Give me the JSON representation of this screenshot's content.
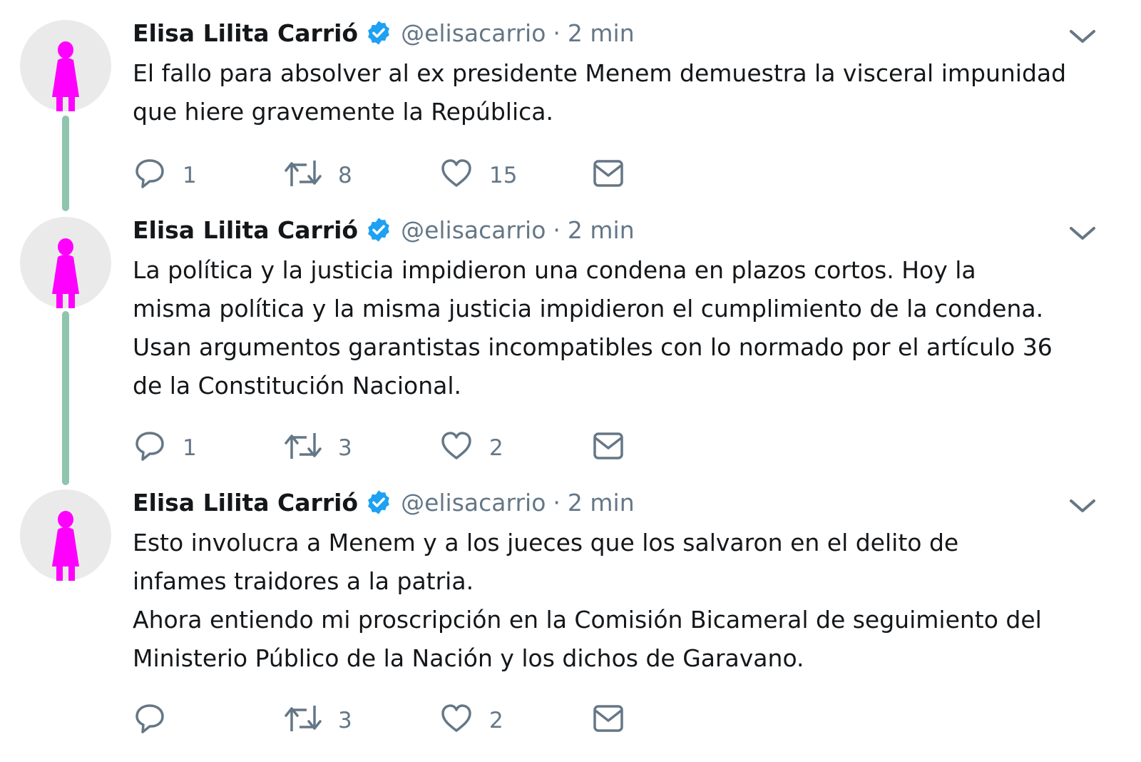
{
  "tweets": [
    {
      "author_name": "Elisa Lilita Carrió",
      "handle": "@elisacarrio",
      "separator": "·",
      "time": "2 min",
      "text_paragraphs": [
        "El fallo para absolver al ex presidente Menem demuestra la visceral impunidad que hiere gravemente la República."
      ],
      "replies": "1",
      "retweets": "8",
      "likes": "15"
    },
    {
      "author_name": "Elisa Lilita Carrió",
      "handle": "@elisacarrio",
      "separator": "·",
      "time": "2 min",
      "text_paragraphs": [
        "La política y la justicia impidieron una condena en plazos cortos. Hoy la misma política y la misma justicia impidieron el cumplimiento de la condena. Usan argumentos garantistas incompatibles con lo normado por el artículo 36 de la Constitución Nacional."
      ],
      "replies": "1",
      "retweets": "3",
      "likes": "2"
    },
    {
      "author_name": "Elisa Lilita Carrió",
      "handle": "@elisacarrio",
      "separator": "·",
      "time": "2 min",
      "text_paragraphs": [
        "Esto involucra a Menem y a los jueces que los salvaron en el delito de infames traidores a la patria.",
        "Ahora entiendo mi proscripción en la Comisión Bicameral de seguimiento del Ministerio Público de la Nación y los dichos de Garavano."
      ],
      "replies": "",
      "retweets": "3",
      "likes": "2"
    }
  ],
  "icons": {
    "reply": "reply-icon",
    "retweet": "retweet-icon",
    "like": "heart-icon",
    "dm": "envelope-icon",
    "verified": "verified-badge-icon",
    "caret": "chevron-down-icon",
    "avatar": "avatar-figure-icon"
  },
  "colors": {
    "avatar_figure": "#ff00ff",
    "avatar_bg": "#eaeaea",
    "thread_line": "#8ec5ad",
    "verified_badge": "#1da1f2",
    "secondary_text": "#657786",
    "primary_text": "#14171a"
  }
}
